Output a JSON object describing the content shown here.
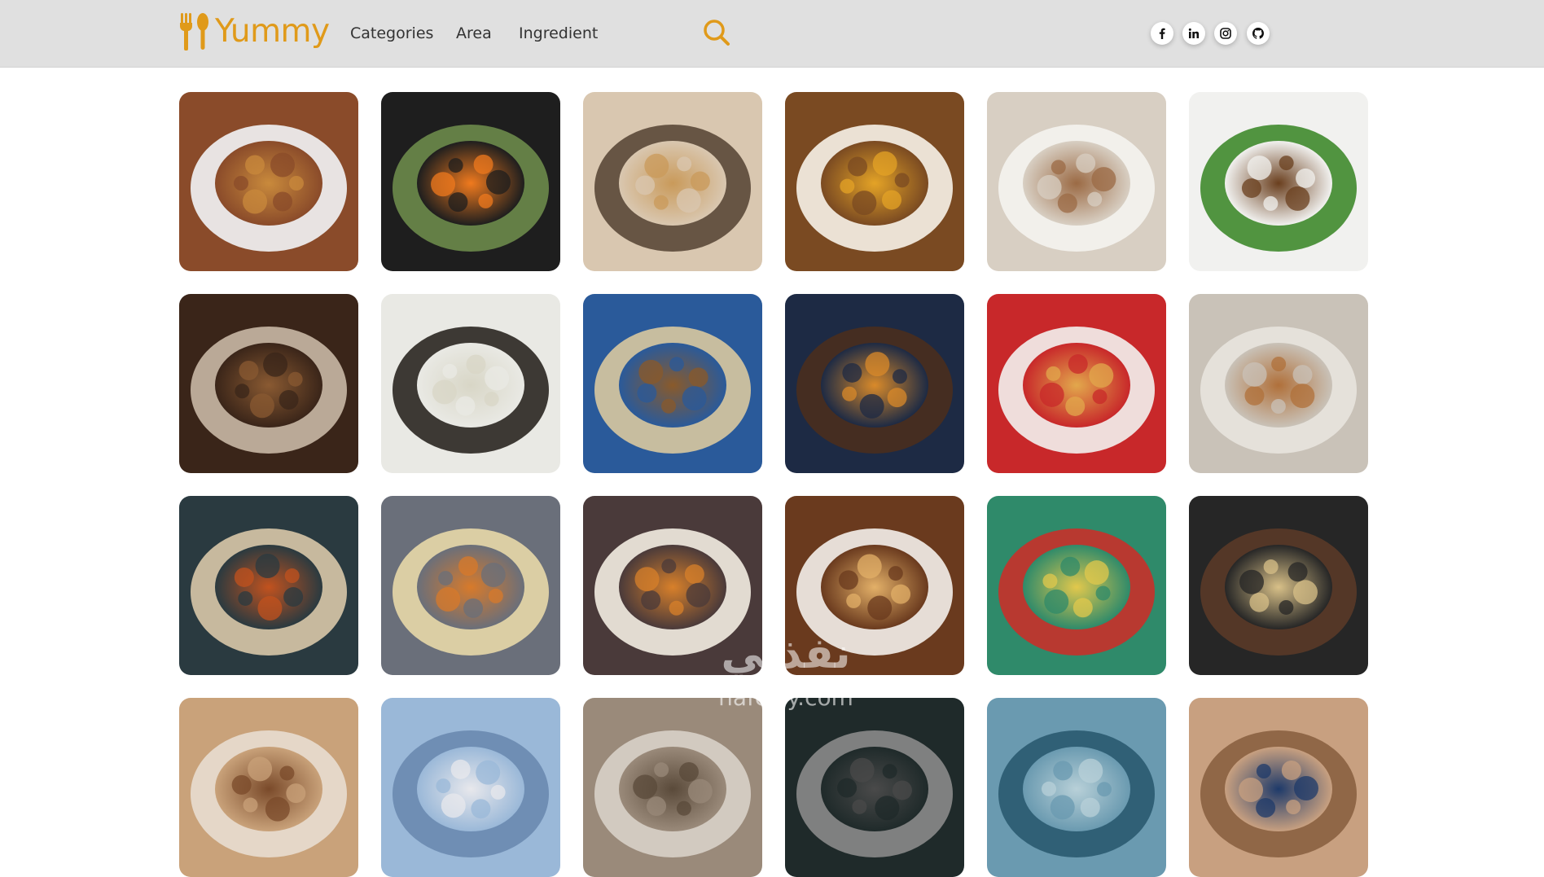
{
  "brand": {
    "name": "Yummy",
    "color": "#e09a1a"
  },
  "nav": {
    "links": [
      {
        "label": "Categories"
      },
      {
        "label": "Area"
      },
      {
        "label": "Ingredient"
      }
    ],
    "search_icon": "search-icon"
  },
  "social": [
    {
      "name": "facebook-icon",
      "label": "f"
    },
    {
      "name": "linkedin-icon",
      "label": "in"
    },
    {
      "name": "instagram-icon",
      "label": "instagram"
    },
    {
      "name": "github-icon",
      "label": "github"
    }
  ],
  "meals": [
    {
      "name": "meal-stew-in-bowl",
      "colors": [
        "#8a4b2a",
        "#c98a3c",
        "#f2f4f6"
      ]
    },
    {
      "name": "meal-sushi-rolls",
      "colors": [
        "#1e1e1e",
        "#f07a1e",
        "#6b8a4a"
      ]
    },
    {
      "name": "meal-meat-pie",
      "colors": [
        "#d9c7b0",
        "#c99a5a",
        "#5a4838"
      ]
    },
    {
      "name": "meal-lentil-soup",
      "colors": [
        "#7a4a22",
        "#e4a326",
        "#f7f2e8"
      ]
    },
    {
      "name": "meal-stuffed-potato",
      "colors": [
        "#d8cfc3",
        "#9b6a44",
        "#f5f3ef"
      ]
    },
    {
      "name": "meal-falafel",
      "colors": [
        "#f1f1ef",
        "#6a3f1e",
        "#3f8a2c"
      ]
    },
    {
      "name": "meal-liver-and-onions",
      "colors": [
        "#3a2519",
        "#8a5a32",
        "#c9b8a5"
      ]
    },
    {
      "name": "meal-dumplings",
      "colors": [
        "#e9e9e4",
        "#d8d6c6",
        "#2a2620"
      ]
    },
    {
      "name": "meal-tagine-plate",
      "colors": [
        "#2a5a9a",
        "#8a5a2a",
        "#d8c8a0"
      ]
    },
    {
      "name": "meal-burger",
      "colors": [
        "#1d2a44",
        "#d98a2a",
        "#4a2e1e"
      ]
    },
    {
      "name": "meal-lasagna",
      "colors": [
        "#c8282a",
        "#e2a84c",
        "#f3f1ee"
      ]
    },
    {
      "name": "meal-fried-dough-balls",
      "colors": [
        "#c9c2b8",
        "#b0703a",
        "#e8e4de"
      ]
    },
    {
      "name": "meal-harira-soup",
      "colors": [
        "#2a3a40",
        "#c2521e",
        "#d8c8a8"
      ]
    },
    {
      "name": "meal-koshari",
      "colors": [
        "#6a6f7a",
        "#d87a2a",
        "#e8d8a8"
      ]
    },
    {
      "name": "meal-poutine",
      "colors": [
        "#4a3a3a",
        "#d8802a",
        "#f3ede2"
      ]
    },
    {
      "name": "meal-pancakes",
      "colors": [
        "#6a3a1e",
        "#e3b068",
        "#f4f0ea"
      ]
    },
    {
      "name": "meal-nachos",
      "colors": [
        "#2f8a6a",
        "#e2c84c",
        "#c8302a"
      ]
    },
    {
      "name": "meal-moussaka",
      "colors": [
        "#262626",
        "#d8c088",
        "#5a3a28"
      ]
    },
    {
      "name": "meal-partial-1",
      "colors": [
        "#c9a27a",
        "#7a4a2a",
        "#e8ddd0"
      ]
    },
    {
      "name": "meal-partial-2",
      "colors": [
        "#9ab8d8",
        "#e8e8ec",
        "#6a8ab0"
      ]
    },
    {
      "name": "meal-partial-3",
      "colors": [
        "#9a8a7a",
        "#5a4a3a",
        "#d8d0c8"
      ]
    },
    {
      "name": "meal-partial-4",
      "colors": [
        "#1f2a2a",
        "#4a4a4a",
        "#8a8a8a"
      ]
    },
    {
      "name": "meal-partial-5",
      "colors": [
        "#6a9ab0",
        "#b8d0d8",
        "#2a5a70"
      ]
    },
    {
      "name": "meal-partial-6",
      "colors": [
        "#c8a080",
        "#1e3a6a",
        "#8a6040"
      ]
    }
  ],
  "watermark": {
    "arabic": "نفذلي",
    "latin": "nafezly.com"
  }
}
